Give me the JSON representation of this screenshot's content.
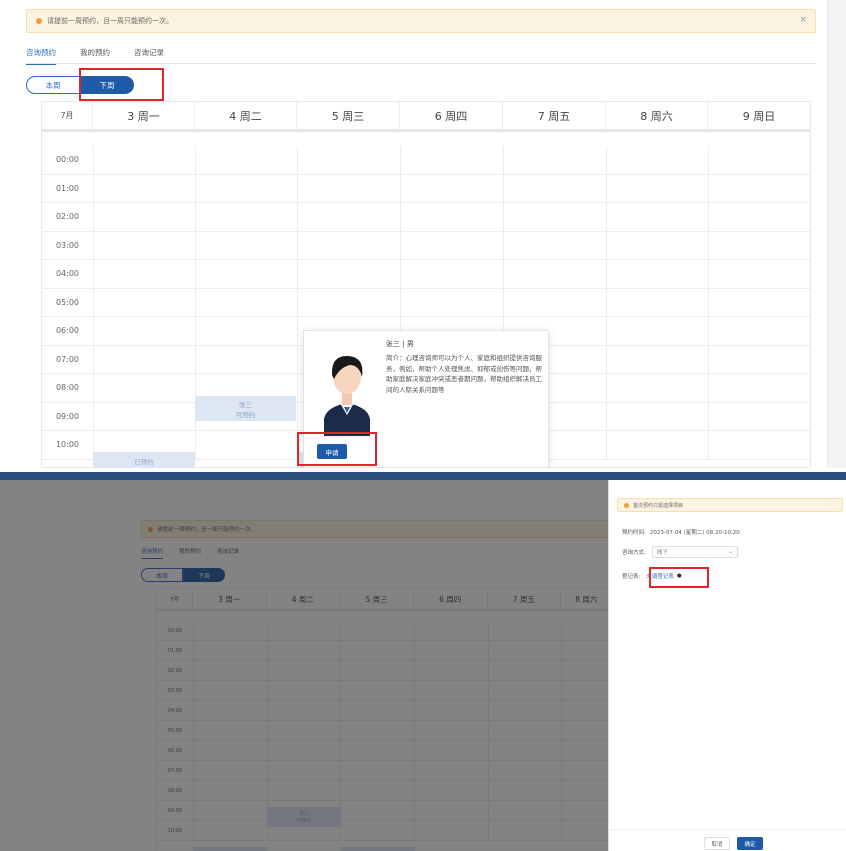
{
  "notice_text": "请提前一周预约，且一周只能预约一次。",
  "close_glyph": "×",
  "tabs": [
    "咨询预约",
    "我的预约",
    "咨询记录"
  ],
  "week_toggle": {
    "this_week": "本周",
    "next_week": "下周"
  },
  "calendar": {
    "month": "7月",
    "days": [
      "3 周一",
      "4 周二",
      "5 周三",
      "6 周四",
      "7 周五",
      "8 周六",
      "9 周日"
    ],
    "times": [
      "00:00",
      "01:00",
      "02:00",
      "03:00",
      "04:00",
      "05:00",
      "06:00",
      "07:00",
      "08:00",
      "09:00",
      "10:00"
    ],
    "slot_tue": {
      "name": "张三",
      "status": "可预约"
    },
    "slot_mon": {
      "status": "已预约"
    }
  },
  "popover": {
    "counselor": "张三 | 男",
    "bio": "简介：心理咨询师可以为个人、家庭和组织提供咨询服务，例如，帮助个人处理焦虑、抑郁或创伤等问题，帮助家庭解决家庭冲突或恶者期问题，帮助组织解决员工间的人际关系问题等",
    "apply_label": "申请"
  },
  "drawer": {
    "notice": "首次预约只需选择项目",
    "appt_time_label": "预约时间:",
    "appt_time_value": "2023-07-04 (星期二) 08:20-10:20",
    "method_label": "咨询方式:",
    "method_value": "线下",
    "register_label": "登记表:",
    "register_link": "未填登记表",
    "cancel_label": "取消",
    "confirm_label": "确定"
  },
  "colors": {
    "primary": "#1f5aa8",
    "highlight": "#e0262b",
    "notice_bg": "#fdf3e1",
    "notice_dot": "#f0a030"
  }
}
